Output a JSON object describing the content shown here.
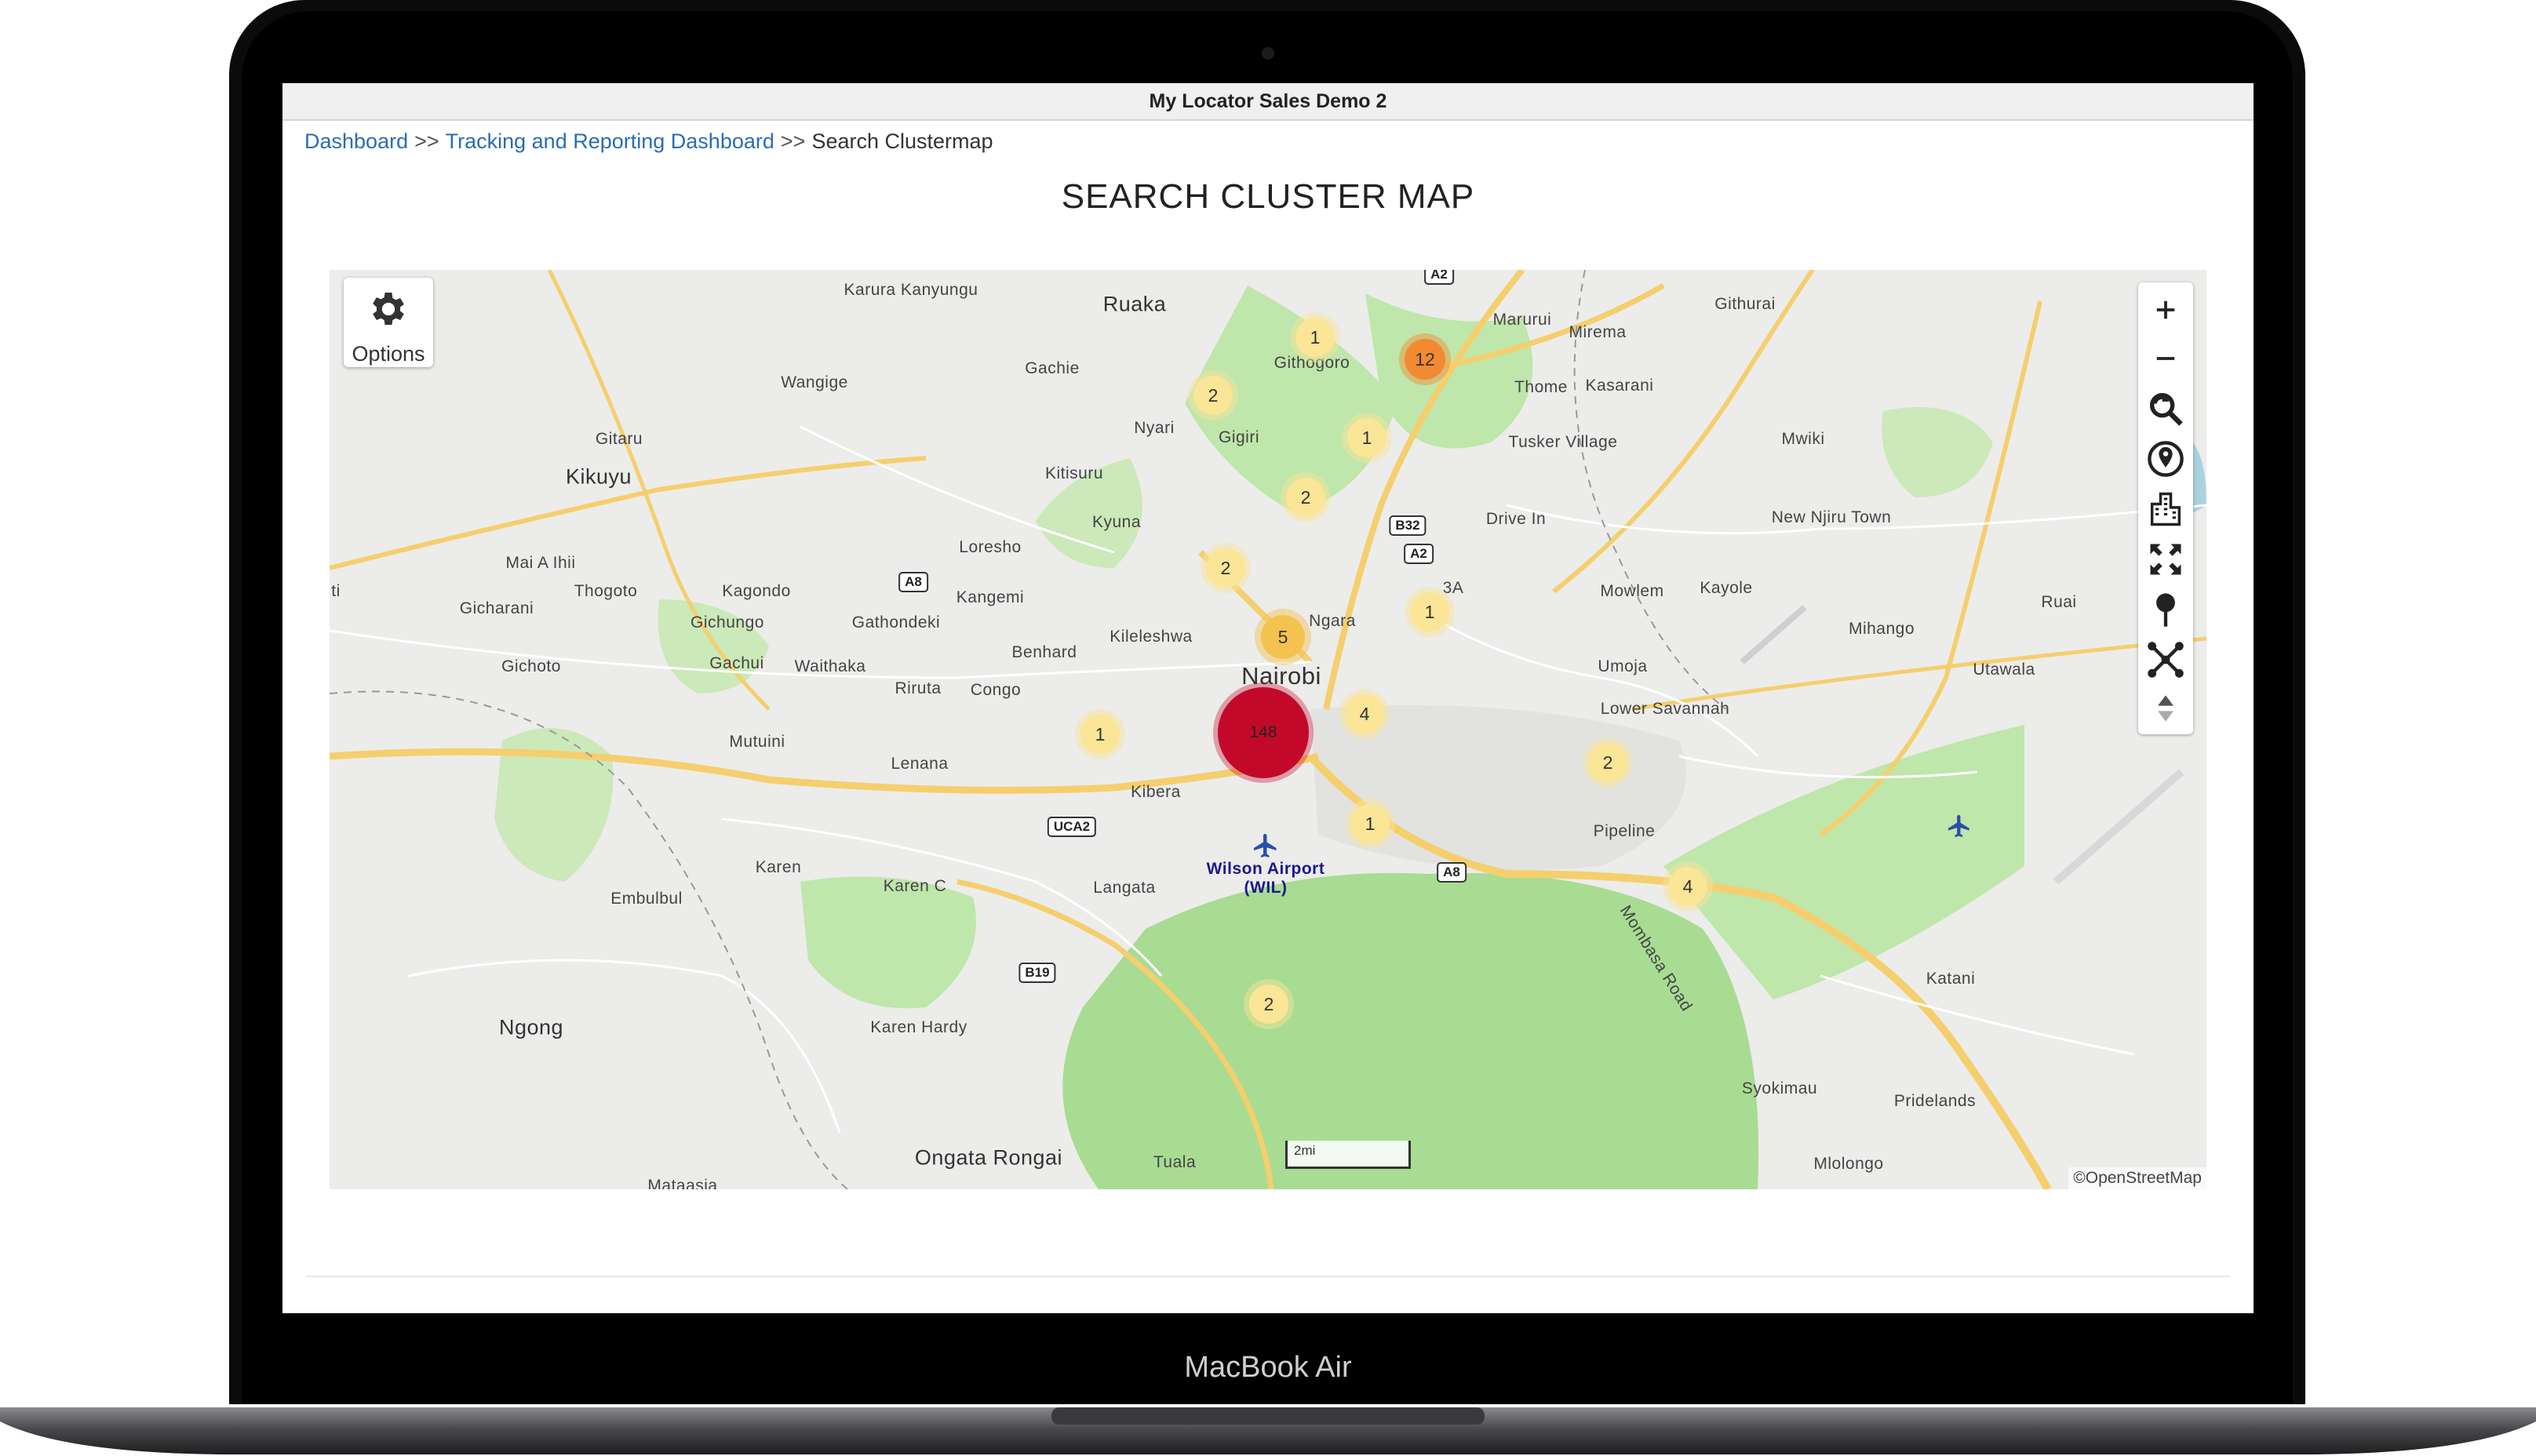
{
  "window": {
    "title": "My Locator Sales Demo 2"
  },
  "breadcrumb": {
    "items": [
      "Dashboard",
      "Tracking and Reporting Dashboard",
      "Search Clustermap"
    ],
    "separator": ">>"
  },
  "page": {
    "title": "SEARCH CLUSTER MAP"
  },
  "map": {
    "options_label": "Options",
    "scale_label": "2mi",
    "attribution": "©OpenStreetMap",
    "places": {
      "nairobi": "Nairobi",
      "karura": "Karura Kanyungu",
      "ruaka": "Ruaka",
      "gachie": "Gachie",
      "githogoro": "Githogoro",
      "wangige": "Wangige",
      "gitaru": "Gitaru",
      "kikuyu": "Kikuyu",
      "nyari": "Nyari",
      "gigiri": "Gigiri",
      "kitisuru": "Kitisuru",
      "kyuna": "Kyuna",
      "loresho": "Loresho",
      "mai_a_ihii": "Mai A Ihii",
      "kangemi": "Kangemi",
      "thogoto": "Thogoto",
      "gicharani": "Gicharani",
      "kagondo": "Kagondo",
      "gichungo": "Gichungo",
      "gathondeki": "Gathondeki",
      "kileleshwa": "Kileleshwa",
      "ngara": "Ngara",
      "benhard": "Benhard",
      "gichoto": "Gichoto",
      "gachui": "Gachui",
      "waithaka": "Waithaka",
      "riruta": "Riruta",
      "congo": "Congo",
      "mutuini": "Mutuini",
      "lenana": "Lenana",
      "kibera": "Kibera",
      "karen": "Karen",
      "karen_c": "Karen C",
      "langata": "Langata",
      "wilson_airport": "Wilson Airport (WIL)",
      "embulbul": "Embulbul",
      "ngong": "Ngong",
      "karen_hardy": "Karen Hardy",
      "ongata_rongai": "Ongata Rongai",
      "tuala": "Tuala",
      "mataasia": "Mataasia",
      "marurui": "Marurui",
      "mirema": "Mirema",
      "githurai": "Githurai",
      "thome": "Thome",
      "kasarani": "Kasarani",
      "tusker_village": "Tusker Village",
      "mwiki": "Mwiki",
      "drive_in": "Drive In",
      "new_njiru_town": "New Njiru Town",
      "mowlem": "Mowlem",
      "kayole": "Kayole",
      "umoja": "Umoja",
      "lower_savannah": "Lower Savannah",
      "mihango": "Mihango",
      "ruai": "Ruai",
      "utawala": "Utawala",
      "pipeline": "Pipeline",
      "mombasa_road": "Mombasa Road",
      "katani": "Katani",
      "syokimau": "Syokimau",
      "pridelands": "Pridelands",
      "mlolongo": "Mlolongo",
      "ti": "ti",
      "label_3a": "3A"
    },
    "roads": [
      "A8",
      "B32",
      "A2",
      "UCA2",
      "B19",
      "A8",
      "A2"
    ],
    "clusters": [
      {
        "count": "148",
        "level": "large"
      },
      {
        "count": "12",
        "level": "orange"
      },
      {
        "count": "5",
        "level": "medium"
      },
      {
        "count": "4",
        "level": "small"
      },
      {
        "count": "4",
        "level": "small"
      },
      {
        "count": "2",
        "level": "small"
      },
      {
        "count": "2",
        "level": "small"
      },
      {
        "count": "2",
        "level": "small"
      },
      {
        "count": "2",
        "level": "small"
      },
      {
        "count": "2",
        "level": "small"
      },
      {
        "count": "1",
        "level": "small"
      },
      {
        "count": "1",
        "level": "small"
      },
      {
        "count": "1",
        "level": "small"
      },
      {
        "count": "1",
        "level": "small"
      },
      {
        "count": "1",
        "level": "small"
      }
    ],
    "toolbar_icons": [
      "zoom-in-icon",
      "zoom-out-icon",
      "search-zoom-icon",
      "locate-icon",
      "buildings-icon",
      "fullscreen-icon",
      "marker-icon",
      "network-icon",
      "pan-icon"
    ]
  },
  "laptop": {
    "brand": "MacBook Air"
  },
  "colors": {
    "link": "#2a6db5",
    "cluster_large": "#c3092a",
    "cluster_orange": "#f28a32",
    "cluster_medium": "#f4c24e",
    "cluster_small": "#fbe597",
    "park_green": "#a8dc92",
    "road_yellow": "#f5cf6e"
  }
}
